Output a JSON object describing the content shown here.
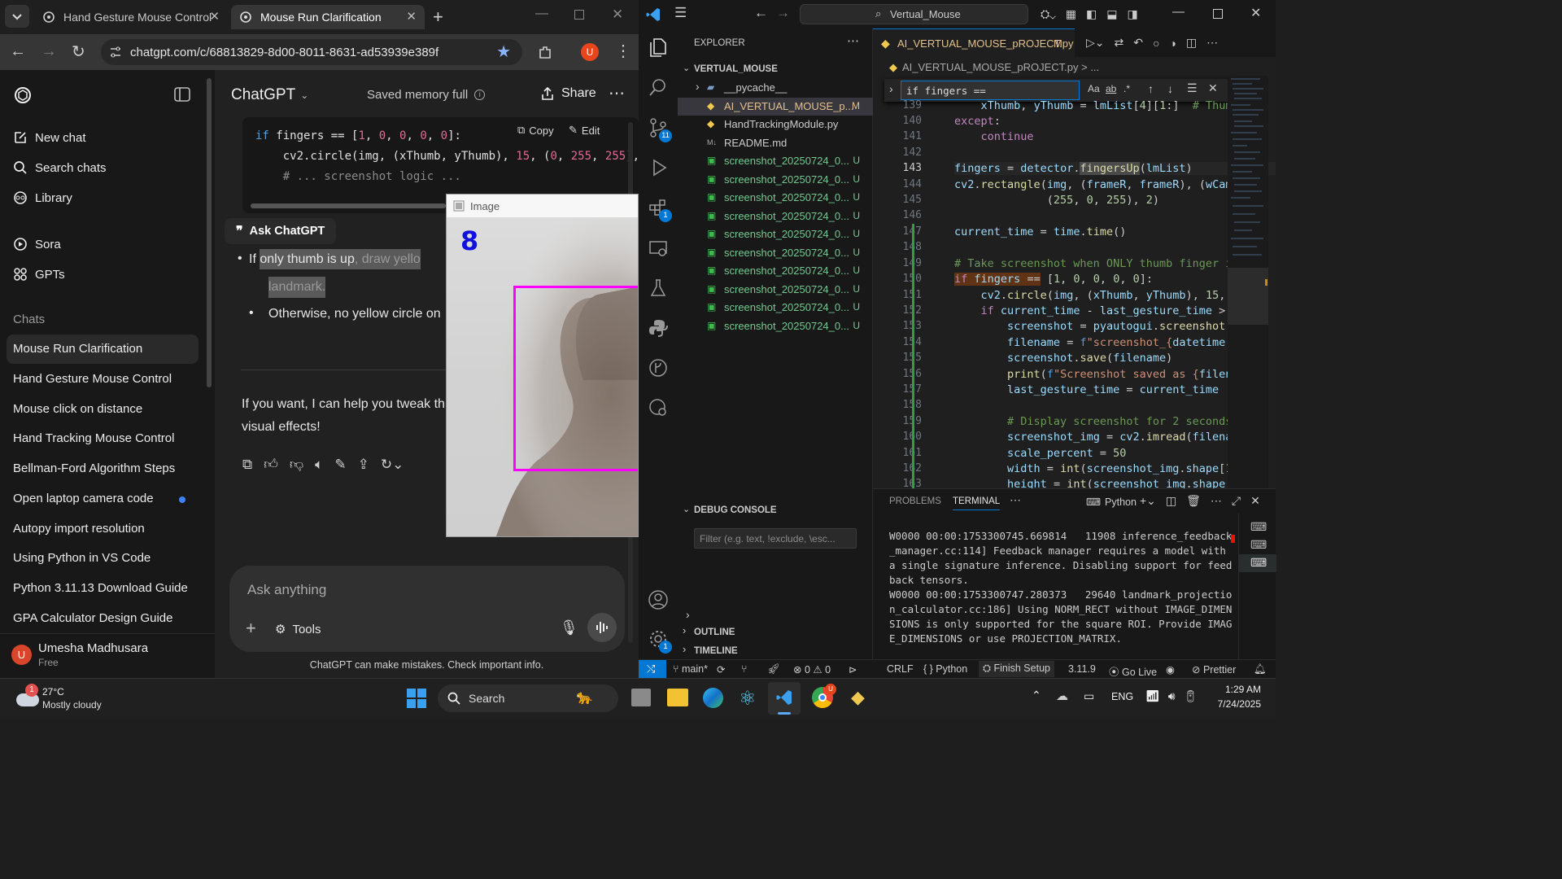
{
  "browser": {
    "tabs": [
      {
        "title": "Hand Gesture Mouse Control"
      },
      {
        "title": "Mouse Run Clarification"
      }
    ],
    "url": "chatgpt.com/c/68813829-8d00-8011-8631-ad53939e389f",
    "profile_initial": "U"
  },
  "chatgpt": {
    "nav": {
      "new_chat": "New chat",
      "search_chats": "Search chats",
      "library": "Library",
      "sora": "Sora",
      "gpts": "GPTs"
    },
    "chats_header": "Chats",
    "chats": [
      "Mouse Run Clarification",
      "Hand Gesture Mouse Control",
      "Mouse click on distance",
      "Hand Tracking Mouse Control",
      "Bellman-Ford Algorithm Steps",
      "Open laptop camera code",
      "Autopy import resolution",
      "Using Python in VS Code",
      "Python 3.11.13 Download Guide",
      "GPA Calculator Design Guide"
    ],
    "user": {
      "name": "Umesha Madhusara",
      "plan": "Free",
      "initial": "U"
    },
    "header": {
      "model": "ChatGPT",
      "memory": "Saved memory full",
      "share": "Share"
    },
    "code": {
      "copy": "Copy",
      "edit": "Edit",
      "line1_kw": "if",
      "line1_a": " fingers == [",
      "line1_nums": [
        "1",
        "0",
        "0",
        "0",
        "0"
      ],
      "line1_b": "]:",
      "line2_a": "    cv2.circle(img, (xThumb, yThumb), ",
      "line2_n1": "15",
      "line2_b": ", (",
      "line2_n2": "0",
      "line2_c": ", ",
      "line2_n3": "255",
      "line2_d": ", ",
      "line2_n4": "255",
      "line2_e": "),",
      "line3": "    # ... screenshot logic ..."
    },
    "ask_chatgpt": "Ask ChatGPT",
    "bullet1_prefix": "If ",
    "bullet1_highlight": "only thumb is up",
    "bullet1_rest": ", draw yello",
    "bullet1_line2": "landmark.",
    "bullet2": "Otherwise, no yellow circle on",
    "followup_line1": "If you want, I can help you tweak th",
    "followup_line2": "visual effects!",
    "composer_placeholder": "Ask anything",
    "tools": "Tools",
    "disclaimer": "ChatGPT can make mistakes. Check important info."
  },
  "image_window": {
    "title": "Image",
    "finger_count": "8",
    "rect_color": "#ff00ff",
    "count_color": "#1010e0"
  },
  "vscode": {
    "search": "Vertual_Mouse",
    "explorer_title": "EXPLORER",
    "folder": "VERTUAL_MOUSE",
    "files": [
      {
        "name": "__pycache__",
        "badge": "",
        "color": "#cccccc"
      },
      {
        "name": "AI_VERTUAL_MOUSE_p...",
        "badge": "M",
        "color": "#e2c08d"
      },
      {
        "name": "HandTrackingModule.py",
        "badge": "",
        "color": "#cccccc"
      },
      {
        "name": "README.md",
        "badge": "",
        "color": "#cccccc"
      },
      {
        "name": "screenshot_20250724_0...",
        "badge": "U",
        "color": "#73c991"
      },
      {
        "name": "screenshot_20250724_0...",
        "badge": "U",
        "color": "#73c991"
      },
      {
        "name": "screenshot_20250724_0...",
        "badge": "U",
        "color": "#73c991"
      },
      {
        "name": "screenshot_20250724_0...",
        "badge": "U",
        "color": "#73c991"
      },
      {
        "name": "screenshot_20250724_0...",
        "badge": "U",
        "color": "#73c991"
      },
      {
        "name": "screenshot_20250724_0...",
        "badge": "U",
        "color": "#73c991"
      },
      {
        "name": "screenshot_20250724_0...",
        "badge": "U",
        "color": "#73c991"
      },
      {
        "name": "screenshot_20250724_0...",
        "badge": "U",
        "color": "#73c991"
      },
      {
        "name": "screenshot_20250724_0...",
        "badge": "U",
        "color": "#73c991"
      },
      {
        "name": "screenshot_20250724_0...",
        "badge": "U",
        "color": "#73c991"
      }
    ],
    "debug_console": "DEBUG CONSOLE",
    "debug_filter_placeholder": "Filter (e.g. text, !exclude, \\esc...",
    "outline": "OUTLINE",
    "timeline": "TIMELINE",
    "editor_tab": "AI_VERTUAL_MOUSE_pROJECT.py",
    "editor_tab_badge": "M",
    "breadcrumb": "AI_VERTUAL_MOUSE_pROJECT.py > ...",
    "find_value": "if fingers ==",
    "line_numbers": [
      "139",
      "140",
      "141",
      "142",
      "143",
      "144",
      "145",
      "146",
      "147",
      "148",
      "149",
      "150",
      "151",
      "152",
      "153",
      "154",
      "155",
      "156",
      "157",
      "158",
      "159",
      "160",
      "161",
      "162",
      "163"
    ],
    "current_line": "143",
    "panel_tabs": {
      "problems": "PROBLEMS",
      "terminal": "TERMINAL"
    },
    "terminal_type": "Python",
    "terminal_lines": [
      "W0000 00:00:1753300745.669814   11908 inference_feedback",
      "_manager.cc:114] Feedback manager requires a model with",
      "a single signature inference. Disabling support for feed",
      "back tensors.",
      "W0000 00:00:1753300747.280373   29640 landmark_projectio",
      "n_calculator.cc:186] Using NORM_RECT without IMAGE_DIMEN",
      "SIONS is only supported for the square ROI. Provide IMAG",
      "E_DIMENSIONS or use PROJECTION_MATRIX."
    ],
    "status": {
      "branch": "main*",
      "errors": "0",
      "warnings": "0",
      "eol": "CRLF",
      "language": "Python",
      "finish_setup": "Finish Setup",
      "python_version": "3.11.9",
      "go_live": "Go Live",
      "prettier": "Prettier"
    },
    "activity_badges": {
      "scm": "11",
      "extensions": "1",
      "manage": "1"
    }
  },
  "taskbar": {
    "weather_temp": "27°C",
    "weather_desc": "Mostly cloudy",
    "weather_badge": "1",
    "search": "Search",
    "language": "ENG",
    "time": "1:29 AM",
    "date": "7/24/2025"
  }
}
